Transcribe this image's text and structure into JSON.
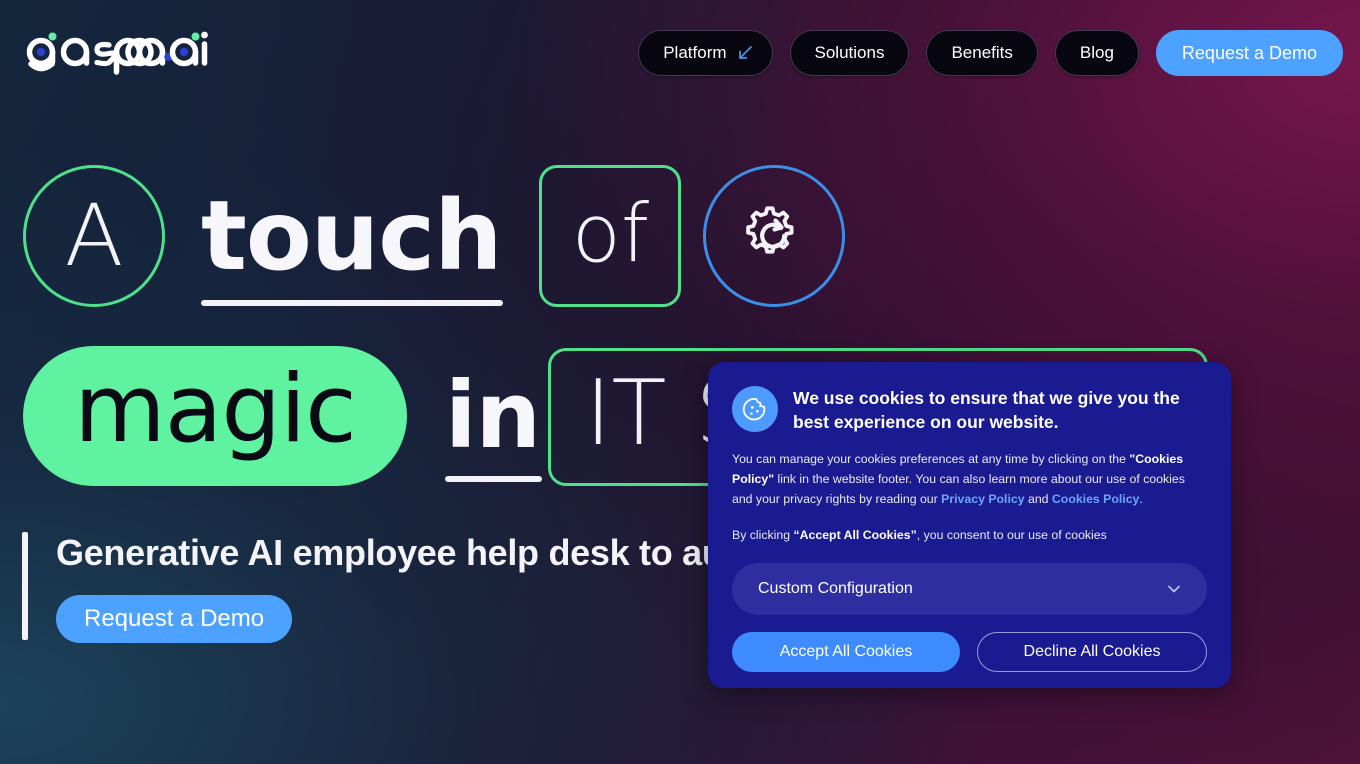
{
  "brand": {
    "logo_text": "gasparai",
    "accent_green": "#5EF2A1",
    "accent_blue": "#4DA2FF",
    "dialog_blue": "#1B1B91"
  },
  "header": {
    "nav": [
      {
        "label": "Platform",
        "icon": "arrow-down-left-icon"
      },
      {
        "label": "Solutions",
        "icon": ""
      },
      {
        "label": "Benefits",
        "icon": ""
      },
      {
        "label": "Blog",
        "icon": ""
      }
    ],
    "cta_label": "Request a Demo"
  },
  "hero": {
    "line1": {
      "token_a": "A",
      "token_touch": "touch",
      "token_of": "of",
      "token_gear_icon": "gear-refresh-icon"
    },
    "line2": {
      "token_magic": "magic",
      "token_in": "in",
      "token_it_support": "IT Support"
    },
    "subheading": "Generative AI employee help desk to auto-",
    "cta_label": "Request a Demo"
  },
  "cookie_dialog": {
    "icon": "cookie-icon",
    "title": "We use cookies to ensure that we give you the best experience on our website.",
    "body_part1": "You can manage your cookies preferences at any time by clicking on the ",
    "body_bold1": "\"Cookies Policy\"",
    "body_part2": " link in the website footer. You can also learn more about our use of cookies and your privacy rights by reading our ",
    "link_privacy": "Privacy Policy",
    "body_and": " and ",
    "link_cookies": "Cookies Policy",
    "body_end": ".",
    "consent_part1": "By clicking ",
    "consent_bold": "“Accept All Cookies”",
    "consent_part2": ", you consent to our use of cookies",
    "select_value": "Custom Configuration",
    "select_icon": "chevron-down-icon",
    "accept_label": "Accept All Cookies",
    "decline_label": "Decline All Cookies"
  }
}
